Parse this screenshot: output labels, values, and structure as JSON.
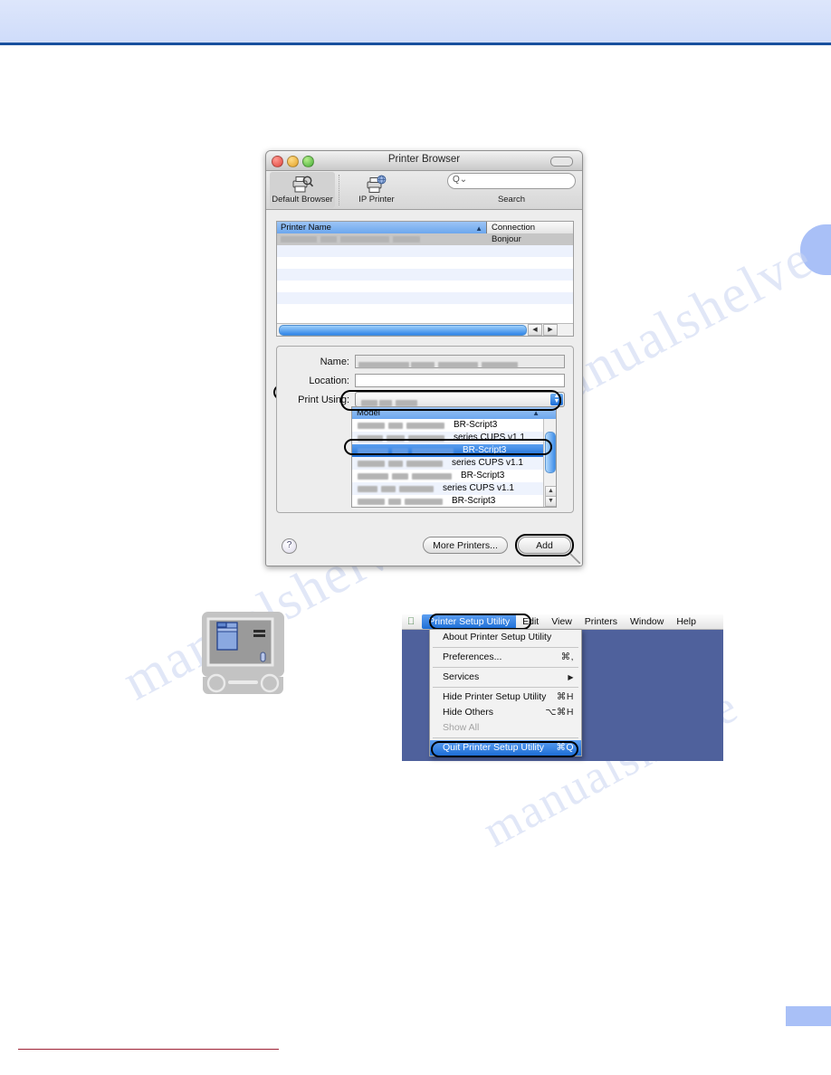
{
  "page": {
    "header_band": "",
    "side_tab": "",
    "page_number": "",
    "watermark": [
      "manualshelve",
      "manualshelve",
      "manualshelve"
    ]
  },
  "printer_browser": {
    "title": "Printer Browser",
    "toolbar": {
      "default_browser_label": "Default Browser",
      "ip_printer_label": "IP Printer",
      "search_placeholder": "",
      "search_label": "Search",
      "search_glyph": "Q⌄"
    },
    "printer_list": {
      "columns": [
        "Printer Name",
        "Connection"
      ],
      "sort_indicator": "▲",
      "rows": [
        {
          "name": "",
          "connection": "Bonjour",
          "selected": true
        },
        {
          "name": "",
          "connection": ""
        },
        {
          "name": "",
          "connection": ""
        },
        {
          "name": "",
          "connection": ""
        },
        {
          "name": "",
          "connection": ""
        },
        {
          "name": "",
          "connection": ""
        },
        {
          "name": "",
          "connection": ""
        }
      ],
      "scroll_left_arrow": "◀",
      "scroll_right_arrow": "▶"
    },
    "form": {
      "name_label": "Name:",
      "name_value": "",
      "location_label": "Location:",
      "location_value": "",
      "print_using_label": "Print Using:",
      "print_using_value": "",
      "popup_arrows": "▲▼"
    },
    "model_list": {
      "header": "Model",
      "sort_indicator": "▲",
      "rows": [
        {
          "model": "BR-Script3",
          "selected": false
        },
        {
          "model": "series CUPS v1.1",
          "selected": false
        },
        {
          "model": "BR-Script3",
          "selected": true
        },
        {
          "model": "series CUPS v1.1",
          "selected": false
        },
        {
          "model": "BR-Script3",
          "selected": false
        },
        {
          "model": "series CUPS v1.1",
          "selected": false
        },
        {
          "model": "BR-Script3",
          "selected": false
        }
      ],
      "scroll_up_arrow": "▲",
      "scroll_down_arrow": "▼"
    },
    "footer": {
      "help_label": "?",
      "more_printers_label": "More Printers...",
      "add_label": "Add"
    }
  },
  "macos_menu": {
    "apple_logo": "",
    "menubar": [
      {
        "label": "Printer Setup Utility",
        "active": true
      },
      {
        "label": "Edit",
        "active": false
      },
      {
        "label": "View",
        "active": false
      },
      {
        "label": "Printers",
        "active": false
      },
      {
        "label": "Window",
        "active": false
      },
      {
        "label": "Help",
        "active": false
      }
    ],
    "menu_items": [
      {
        "label": "About Printer Setup Utility",
        "key": "",
        "state": "normal",
        "separator_after": true
      },
      {
        "label": "Preferences...",
        "key": "⌘,",
        "state": "normal",
        "separator_after": true
      },
      {
        "label": "Services",
        "key": "▶",
        "state": "normal",
        "separator_after": true
      },
      {
        "label": "Hide Printer Setup Utility",
        "key": "⌘H",
        "state": "normal",
        "separator_after": false
      },
      {
        "label": "Hide Others",
        "key": "⌥⌘H",
        "state": "normal",
        "separator_after": false
      },
      {
        "label": "Show All",
        "key": "",
        "state": "disabled",
        "separator_after": true
      },
      {
        "label": "Quit Printer Setup Utility",
        "key": "⌘Q",
        "state": "highlighted",
        "separator_after": false
      }
    ]
  },
  "colors": {
    "header_band": "#d5e1fb",
    "header_rule": "#18509e",
    "side_tab": "#a9c0f7",
    "footer_rule": "#9e2235",
    "desktop": "#4f619c",
    "selection_blue": "#1d6ed6",
    "annotation_outline": "#000000"
  }
}
